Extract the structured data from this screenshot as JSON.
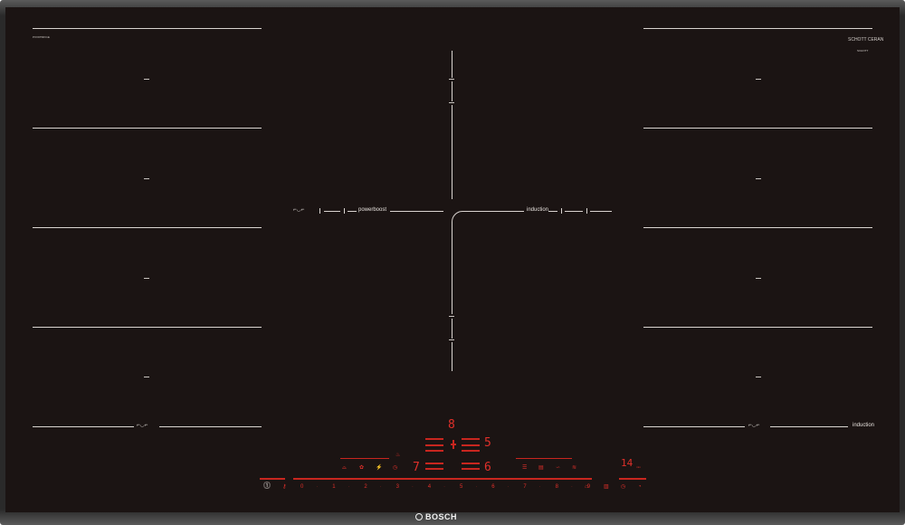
{
  "hob": {
    "model": "PXV975DV1E",
    "glass_brand": "SCHOTT CERAN",
    "glass_sub": "SCHOTT",
    "powerboost_label": "powerboost",
    "induction_label_center": "induction",
    "induction_label_right": "induction",
    "brand": "BOSCH",
    "colors": {
      "glass": "#1b1413",
      "lines": "#d9d4d0",
      "display": "#e0302a",
      "frame": "#2a2a2a"
    }
  },
  "zones": {
    "left_marks": [
      "–",
      "–",
      "–",
      "–"
    ],
    "right_marks": [
      "–",
      "–",
      "–",
      "–"
    ]
  },
  "control": {
    "digit_top": "8",
    "digit_mid_right": "5",
    "digit_left": "7",
    "digit_bottom_right": "6",
    "timer": "14",
    "timer_unit": "min",
    "scale": [
      "0",
      "1",
      "2",
      "3",
      "4",
      "5",
      "6",
      "7",
      "8",
      "9"
    ],
    "icons_left": [
      "pan-icon",
      "flower-icon",
      "power-icon"
    ],
    "icons_right": [
      "settings-icon",
      "menu-icon",
      "fry-icon",
      "wifi-icon"
    ]
  }
}
